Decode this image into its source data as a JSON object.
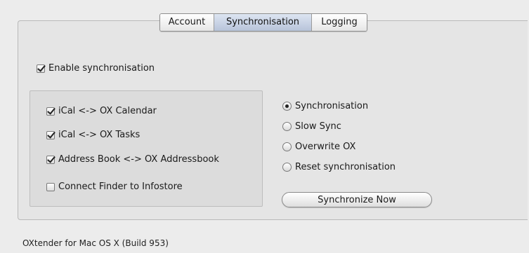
{
  "tabs": {
    "account": "Account",
    "synchronisation": "Synchronisation",
    "logging": "Logging",
    "active": "synchronisation"
  },
  "enable_sync": {
    "label": "Enable synchronisation",
    "checked": true
  },
  "sync_items": [
    {
      "label": "iCal <-> OX Calendar",
      "checked": true
    },
    {
      "label": "iCal <-> OX Tasks",
      "checked": true
    },
    {
      "label": "Address Book <-> OX Addressbook",
      "checked": true
    },
    {
      "label": "Connect Finder to Infostore",
      "checked": false
    }
  ],
  "sync_modes": [
    {
      "label": "Synchronisation",
      "selected": true
    },
    {
      "label": "Slow Sync",
      "selected": false
    },
    {
      "label": "Overwrite OX",
      "selected": false
    },
    {
      "label": "Reset synchronisation",
      "selected": false
    }
  ],
  "sync_now_button": "Synchronize Now",
  "footer_text": "OXtender for Mac OS X (Build 953)"
}
